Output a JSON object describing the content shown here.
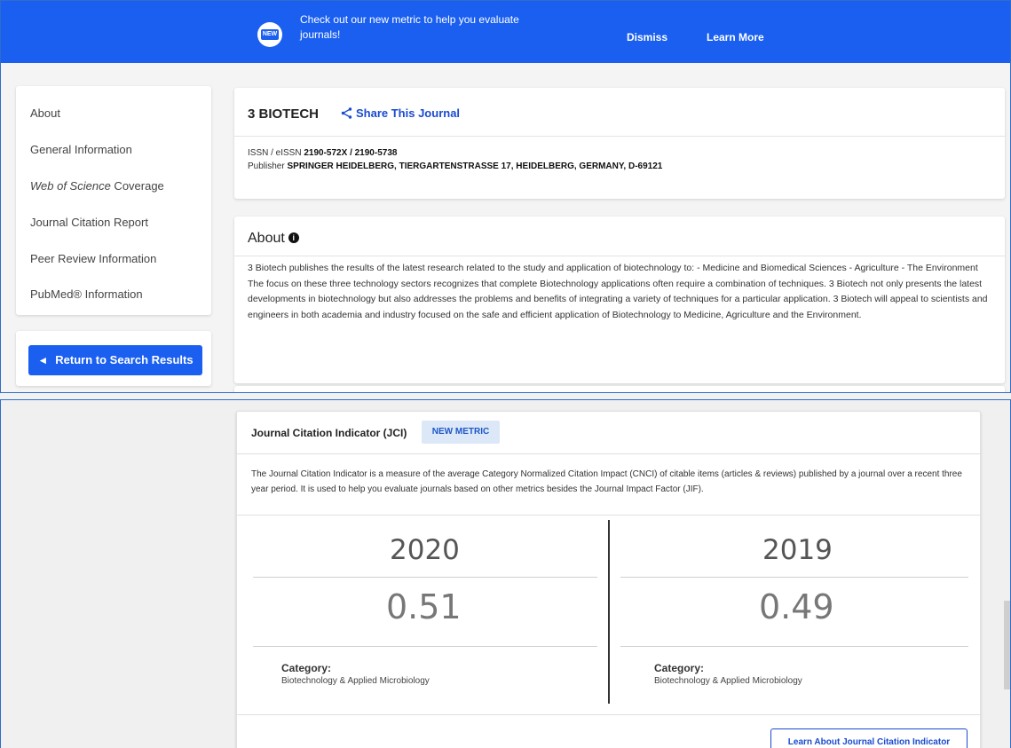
{
  "banner": {
    "badge": "NEW",
    "message": "Check out our new metric to help you evaluate journals!",
    "dismiss": "Dismiss",
    "learn_more": "Learn More",
    "color": "#1a5ff0"
  },
  "sidebar": {
    "items": [
      {
        "label": "About"
      },
      {
        "label": "General Information"
      },
      {
        "label_italic": "Web of Science",
        "label_rest": " Coverage"
      },
      {
        "label": "Journal Citation Report"
      },
      {
        "label": "Peer Review Information"
      },
      {
        "label": "PubMed® Information"
      }
    ],
    "return_button": "Return to Search Results"
  },
  "journal": {
    "title": "3 BIOTECH",
    "share": "Share This Journal",
    "issn_label": "ISSN / eISSN",
    "issn_value": "2190-572X / 2190-5738",
    "publisher_label": "Publisher",
    "publisher_value": "SPRINGER HEIDELBERG, TIERGARTENSTRASSE 17, HEIDELBERG, GERMANY, D-69121"
  },
  "about": {
    "title": "About",
    "text": "3 Biotech publishes the results of the latest research related to the study and application of biotechnology to: - Medicine and Biomedical Sciences - Agriculture - The Environment The focus on these three technology sectors recognizes that complete Biotechnology applications often require a combination of techniques. 3 Biotech not only presents the latest developments in biotechnology but also addresses the problems and benefits of integrating a variety of techniques for a particular application. 3 Biotech will appeal to scientists and engineers in both academia and industry focused on the safe and efficient application of Biotechnology to Medicine, Agriculture and the Environment."
  },
  "jci": {
    "title": "Journal Citation Indicator (JCI)",
    "badge": "NEW METRIC",
    "description": "The Journal Citation Indicator is a measure of the average Category Normalized Citation Impact (CNCI) of citable items (articles & reviews) published by a journal over a recent three year period. It is used to help you evaluate journals based on other metrics besides the Journal Impact Factor (JIF).",
    "columns": [
      {
        "year": "2020",
        "value": "0.51",
        "category_label": "Category:",
        "category": "Biotechnology & Applied Microbiology"
      },
      {
        "year": "2019",
        "value": "0.49",
        "category_label": "Category:",
        "category": "Biotechnology & Applied Microbiology"
      }
    ],
    "learn_button": "Learn About Journal Citation Indicator"
  }
}
